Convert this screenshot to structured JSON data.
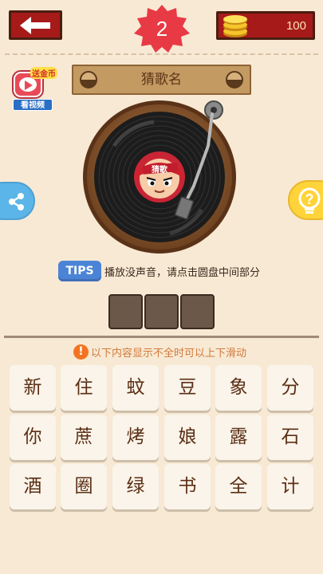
{
  "header": {
    "level": "2",
    "coins": "100"
  },
  "side": {
    "gift_label": "送金币",
    "watch_label": "看视频"
  },
  "puzzle": {
    "title": "猜歌名",
    "record_label": "猜歌",
    "tips_badge": "TIPS",
    "tips_text": "播放没声音，请点击圆盘中间部分",
    "answer_slots": 3
  },
  "scroll_hint": "以下内容显示不全时可以上下滑动",
  "characters": [
    [
      "新",
      "住",
      "蚊",
      "豆",
      "象",
      "分"
    ],
    [
      "你",
      "蔗",
      "烤",
      "娘",
      "露",
      "石"
    ],
    [
      "酒",
      "圈",
      "绿",
      "书",
      "全",
      "计"
    ]
  ],
  "colors": {
    "background": "#f8e9d4",
    "header_red": "#a61a1a",
    "tips_blue": "#4b84d6",
    "slot_brown": "#6b5848"
  }
}
